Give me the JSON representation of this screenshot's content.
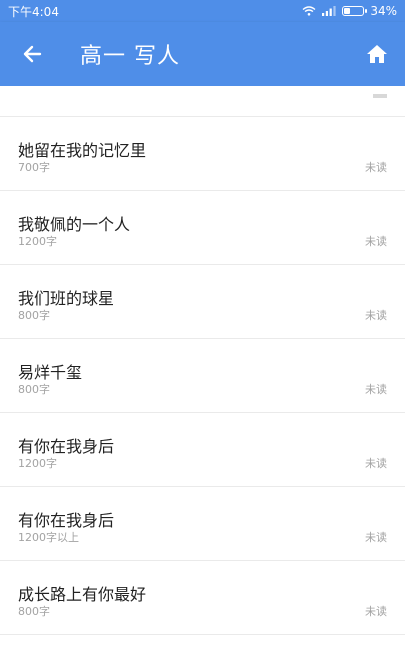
{
  "status_bar": {
    "time": "下午4:04",
    "battery": "34%",
    "battery_level": 0.34
  },
  "app_bar": {
    "title": "高一 写人",
    "back_icon": "arrow-left-icon",
    "home_icon": "home-icon"
  },
  "articles": [
    {
      "title": "她留在我的记忆里",
      "words": "700字",
      "status": "未读"
    },
    {
      "title": "我敬佩的一个人",
      "words": "1200字",
      "status": "未读"
    },
    {
      "title": "我们班的球星",
      "words": "800字",
      "status": "未读"
    },
    {
      "title": "易烊千玺",
      "words": "800字",
      "status": "未读"
    },
    {
      "title": "有你在我身后",
      "words": "1200字",
      "status": "未读"
    },
    {
      "title": "有你在我身后",
      "words": "1200字以上",
      "status": "未读"
    },
    {
      "title": "成长路上有你最好",
      "words": "800字",
      "status": "未读"
    }
  ],
  "colors": {
    "primary": "#4f8ee8",
    "text": "#222222",
    "muted": "#a3a3a3"
  }
}
